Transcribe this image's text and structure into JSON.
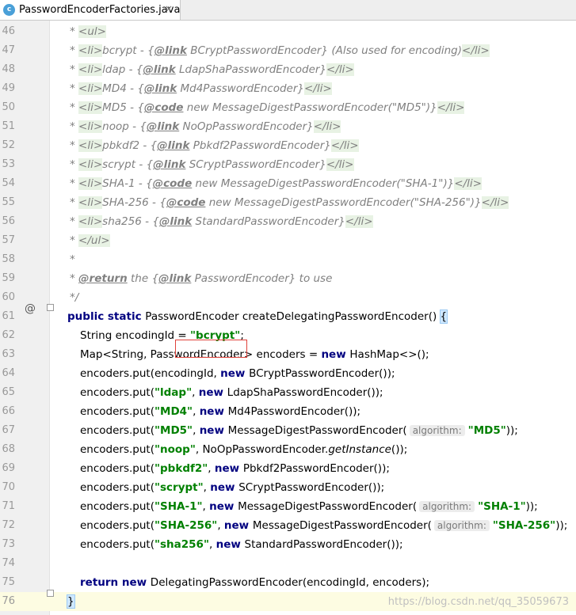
{
  "tab": {
    "icon_letter": "c",
    "title": "PasswordEncoderFactories.java",
    "close_glyph": "×"
  },
  "lines": [
    {
      "n": "46",
      "segs": [
        {
          "t": "* ",
          "c": "cm"
        },
        {
          "t": "<ul>",
          "c": "cm tagbg"
        }
      ]
    },
    {
      "n": "47",
      "segs": [
        {
          "t": "* ",
          "c": "cm"
        },
        {
          "t": "<li>",
          "c": "cm tagbg"
        },
        {
          "t": "bcrypt - {",
          "c": "cm"
        },
        {
          "t": "@link",
          "c": "ctag"
        },
        {
          "t": " BCryptPasswordEncoder",
          "c": "cm"
        },
        {
          "t": "} (Also used for encoding)",
          "c": "cm"
        },
        {
          "t": "</li>",
          "c": "cm tagbg"
        }
      ]
    },
    {
      "n": "48",
      "segs": [
        {
          "t": "* ",
          "c": "cm"
        },
        {
          "t": "<li>",
          "c": "cm tagbg"
        },
        {
          "t": "ldap - {",
          "c": "cm"
        },
        {
          "t": "@link",
          "c": "ctag"
        },
        {
          "t": " LdapShaPasswordEncoder",
          "c": "cm"
        },
        {
          "t": "}",
          "c": "cm"
        },
        {
          "t": "</li>",
          "c": "cm tagbg"
        }
      ]
    },
    {
      "n": "49",
      "segs": [
        {
          "t": "* ",
          "c": "cm"
        },
        {
          "t": "<li>",
          "c": "cm tagbg"
        },
        {
          "t": "MD4 - {",
          "c": "cm"
        },
        {
          "t": "@link",
          "c": "ctag"
        },
        {
          "t": " Md4PasswordEncoder",
          "c": "cm"
        },
        {
          "t": "}",
          "c": "cm"
        },
        {
          "t": "</li>",
          "c": "cm tagbg"
        }
      ]
    },
    {
      "n": "50",
      "segs": [
        {
          "t": "* ",
          "c": "cm"
        },
        {
          "t": "<li>",
          "c": "cm tagbg"
        },
        {
          "t": "MD5 - {",
          "c": "cm"
        },
        {
          "t": "@code",
          "c": "ctag"
        },
        {
          "t": " new MessageDigestPasswordEncoder(\"MD5\")}",
          "c": "cm"
        },
        {
          "t": "</li>",
          "c": "cm tagbg"
        }
      ]
    },
    {
      "n": "51",
      "segs": [
        {
          "t": "* ",
          "c": "cm"
        },
        {
          "t": "<li>",
          "c": "cm tagbg"
        },
        {
          "t": "noop - {",
          "c": "cm"
        },
        {
          "t": "@link",
          "c": "ctag"
        },
        {
          "t": " NoOpPasswordEncoder",
          "c": "cm"
        },
        {
          "t": "}",
          "c": "cm"
        },
        {
          "t": "</li>",
          "c": "cm tagbg"
        }
      ]
    },
    {
      "n": "52",
      "segs": [
        {
          "t": "* ",
          "c": "cm"
        },
        {
          "t": "<li>",
          "c": "cm tagbg"
        },
        {
          "t": "pbkdf2 - {",
          "c": "cm"
        },
        {
          "t": "@link",
          "c": "ctag"
        },
        {
          "t": " Pbkdf2PasswordEncoder",
          "c": "cm"
        },
        {
          "t": "}",
          "c": "cm"
        },
        {
          "t": "</li>",
          "c": "cm tagbg"
        }
      ]
    },
    {
      "n": "53",
      "segs": [
        {
          "t": "* ",
          "c": "cm"
        },
        {
          "t": "<li>",
          "c": "cm tagbg"
        },
        {
          "t": "scrypt - {",
          "c": "cm"
        },
        {
          "t": "@link",
          "c": "ctag"
        },
        {
          "t": " SCryptPasswordEncoder",
          "c": "cm"
        },
        {
          "t": "}",
          "c": "cm"
        },
        {
          "t": "</li>",
          "c": "cm tagbg"
        }
      ]
    },
    {
      "n": "54",
      "segs": [
        {
          "t": "* ",
          "c": "cm"
        },
        {
          "t": "<li>",
          "c": "cm tagbg"
        },
        {
          "t": "SHA-1 - {",
          "c": "cm"
        },
        {
          "t": "@code",
          "c": "ctag"
        },
        {
          "t": " new MessageDigestPasswordEncoder(\"SHA-1\")}",
          "c": "cm"
        },
        {
          "t": "</li>",
          "c": "cm tagbg"
        }
      ]
    },
    {
      "n": "55",
      "segs": [
        {
          "t": "* ",
          "c": "cm"
        },
        {
          "t": "<li>",
          "c": "cm tagbg"
        },
        {
          "t": "SHA-256 - {",
          "c": "cm"
        },
        {
          "t": "@code",
          "c": "ctag"
        },
        {
          "t": " new MessageDigestPasswordEncoder(\"SHA-256\")}",
          "c": "cm"
        },
        {
          "t": "</li>",
          "c": "cm tagbg"
        }
      ]
    },
    {
      "n": "56",
      "segs": [
        {
          "t": "* ",
          "c": "cm"
        },
        {
          "t": "<li>",
          "c": "cm tagbg"
        },
        {
          "t": "sha256 - {",
          "c": "cm"
        },
        {
          "t": "@link",
          "c": "ctag"
        },
        {
          "t": " StandardPasswordEncoder",
          "c": "cm"
        },
        {
          "t": "}",
          "c": "cm"
        },
        {
          "t": "</li>",
          "c": "cm tagbg"
        }
      ]
    },
    {
      "n": "57",
      "segs": [
        {
          "t": "* ",
          "c": "cm"
        },
        {
          "t": "</ul>",
          "c": "cm tagbg"
        }
      ]
    },
    {
      "n": "58",
      "segs": [
        {
          "t": "*",
          "c": "cm"
        }
      ]
    },
    {
      "n": "59",
      "segs": [
        {
          "t": "* ",
          "c": "cm"
        },
        {
          "t": "@return",
          "c": "ctag"
        },
        {
          "t": " the {",
          "c": "cm"
        },
        {
          "t": "@link",
          "c": "ctag"
        },
        {
          "t": " PasswordEncoder",
          "c": "cm"
        },
        {
          "t": "} to use",
          "c": "cm"
        }
      ]
    },
    {
      "n": "60",
      "segs": [
        {
          "t": "*/",
          "c": "cm"
        }
      ]
    },
    {
      "n": "61",
      "segs": [
        {
          "t": "public static ",
          "c": "kw"
        },
        {
          "t": "PasswordEncoder createDelegatingPasswordEncoder() ",
          "c": ""
        },
        {
          "t": "{",
          "c": "brhl"
        }
      ]
    },
    {
      "n": "62",
      "segs": [
        {
          "t": "String encodingId = ",
          "c": ""
        },
        {
          "t": "\"bcrypt\"",
          "c": "str"
        },
        {
          "t": ";",
          "c": ""
        }
      ]
    },
    {
      "n": "63",
      "segs": [
        {
          "t": "Map<String, PasswordEncoder> encoders = ",
          "c": ""
        },
        {
          "t": "new ",
          "c": "kw"
        },
        {
          "t": "HashMap<>();",
          "c": ""
        }
      ]
    },
    {
      "n": "64",
      "segs": [
        {
          "t": "encoders.put(encodingId, ",
          "c": ""
        },
        {
          "t": "new ",
          "c": "kw"
        },
        {
          "t": "BCryptPasswordEncoder());",
          "c": ""
        }
      ]
    },
    {
      "n": "65",
      "segs": [
        {
          "t": "encoders.put(",
          "c": ""
        },
        {
          "t": "\"ldap\"",
          "c": "str"
        },
        {
          "t": ", ",
          "c": ""
        },
        {
          "t": "new ",
          "c": "kw"
        },
        {
          "t": "LdapShaPasswordEncoder());",
          "c": ""
        }
      ]
    },
    {
      "n": "66",
      "segs": [
        {
          "t": "encoders.put(",
          "c": ""
        },
        {
          "t": "\"MD4\"",
          "c": "str"
        },
        {
          "t": ", ",
          "c": ""
        },
        {
          "t": "new ",
          "c": "kw"
        },
        {
          "t": "Md4PasswordEncoder());",
          "c": ""
        }
      ]
    },
    {
      "n": "67",
      "segs": [
        {
          "t": "encoders.put(",
          "c": ""
        },
        {
          "t": "\"MD5\"",
          "c": "str"
        },
        {
          "t": ", ",
          "c": ""
        },
        {
          "t": "new ",
          "c": "kw"
        },
        {
          "t": "MessageDigestPasswordEncoder(",
          "c": ""
        },
        {
          "t": "algorithm:",
          "c": "hint"
        },
        {
          "t": "\"MD5\"",
          "c": "str"
        },
        {
          "t": "));",
          "c": ""
        }
      ]
    },
    {
      "n": "68",
      "segs": [
        {
          "t": "encoders.put(",
          "c": ""
        },
        {
          "t": "\"noop\"",
          "c": "str"
        },
        {
          "t": ", NoOpPasswordEncoder.",
          "c": ""
        },
        {
          "t": "getInstance",
          "c": "ital"
        },
        {
          "t": "());",
          "c": ""
        }
      ]
    },
    {
      "n": "69",
      "segs": [
        {
          "t": "encoders.put(",
          "c": ""
        },
        {
          "t": "\"pbkdf2\"",
          "c": "str"
        },
        {
          "t": ", ",
          "c": ""
        },
        {
          "t": "new ",
          "c": "kw"
        },
        {
          "t": "Pbkdf2PasswordEncoder());",
          "c": ""
        }
      ]
    },
    {
      "n": "70",
      "segs": [
        {
          "t": "encoders.put(",
          "c": ""
        },
        {
          "t": "\"scrypt\"",
          "c": "str"
        },
        {
          "t": ", ",
          "c": ""
        },
        {
          "t": "new ",
          "c": "kw"
        },
        {
          "t": "SCryptPasswordEncoder());",
          "c": ""
        }
      ]
    },
    {
      "n": "71",
      "segs": [
        {
          "t": "encoders.put(",
          "c": ""
        },
        {
          "t": "\"SHA-1\"",
          "c": "str"
        },
        {
          "t": ", ",
          "c": ""
        },
        {
          "t": "new ",
          "c": "kw"
        },
        {
          "t": "MessageDigestPasswordEncoder(",
          "c": ""
        },
        {
          "t": "algorithm:",
          "c": "hint"
        },
        {
          "t": "\"SHA-1\"",
          "c": "str"
        },
        {
          "t": "));",
          "c": ""
        }
      ]
    },
    {
      "n": "72",
      "segs": [
        {
          "t": "encoders.put(",
          "c": ""
        },
        {
          "t": "\"SHA-256\"",
          "c": "str"
        },
        {
          "t": ", ",
          "c": ""
        },
        {
          "t": "new ",
          "c": "kw"
        },
        {
          "t": "MessageDigestPasswordEncoder(",
          "c": ""
        },
        {
          "t": "algorithm:",
          "c": "hint"
        },
        {
          "t": "\"SHA-256\"",
          "c": "str"
        },
        {
          "t": "));",
          "c": ""
        }
      ]
    },
    {
      "n": "73",
      "segs": [
        {
          "t": "encoders.put(",
          "c": ""
        },
        {
          "t": "\"sha256\"",
          "c": "str"
        },
        {
          "t": ", ",
          "c": ""
        },
        {
          "t": "new ",
          "c": "kw"
        },
        {
          "t": "StandardPasswordEncoder());",
          "c": ""
        }
      ]
    },
    {
      "n": "74",
      "segs": []
    },
    {
      "n": "75",
      "segs": [
        {
          "t": "return new ",
          "c": "kw"
        },
        {
          "t": "DelegatingPasswordEncoder(encodingId, encoders);",
          "c": ""
        }
      ]
    },
    {
      "n": "76",
      "segs": [
        {
          "t": "}",
          "c": "brhl"
        }
      ]
    }
  ],
  "gutter": {
    "override_marker": "@"
  },
  "watermark": "https://blog.csdn.net/qq_35059673"
}
